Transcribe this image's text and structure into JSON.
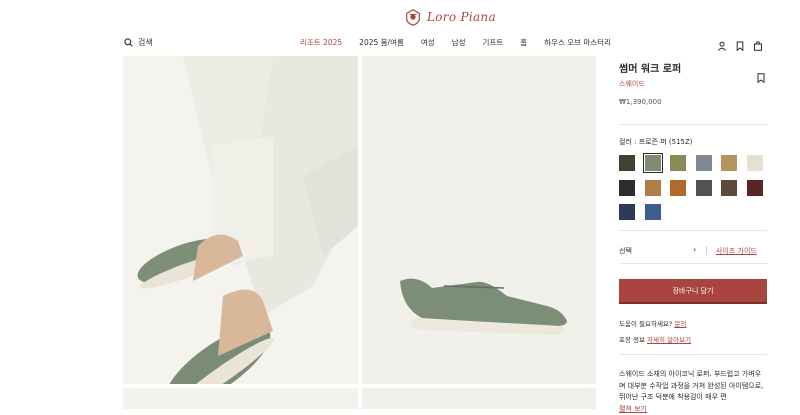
{
  "brand": {
    "name": "Loro Piana"
  },
  "header": {
    "search_label": "검색",
    "nav": [
      "리조트 2025",
      "2025 봄/여름",
      "여성",
      "남성",
      "기프트",
      "홈",
      "하우스 오브 마스터리"
    ],
    "active_nav": "리조트 2025"
  },
  "product": {
    "title": "썸머 워크 로퍼",
    "material": "스웨이드",
    "price": "₩1,390,000",
    "color_label": "컬러 : 프로즌 퍼 (515Z)",
    "swatches": [
      "#3f4232",
      "#7f8c74",
      "#8a8b54",
      "#7d8895",
      "#b3955c",
      "#e6dfd4",
      "#2d2d2d",
      "#b27c48",
      "#b06a2a",
      "#56514e",
      "#5e4a3c",
      "#5a2526",
      "#2b3c59",
      "#3d5d8f"
    ],
    "selected_swatch": 1,
    "size_select": "선택",
    "size_guide": "사이즈 가이드",
    "cart_button": "장바구니 담기",
    "help_text": "도움이 필요하세요?",
    "help_link": "문의",
    "wrap_text": "포장 정보",
    "wrap_link": "자세히 알아보기",
    "description": "스웨이드 소재의 아이코닉 로퍼. 부드럽고 가벼우며 대부분 수작업 과정을 거쳐 완성된 아이템으로, 뛰어난 구조 덕분에 착용감이 매우 편",
    "more": "펼쳐 보기"
  }
}
